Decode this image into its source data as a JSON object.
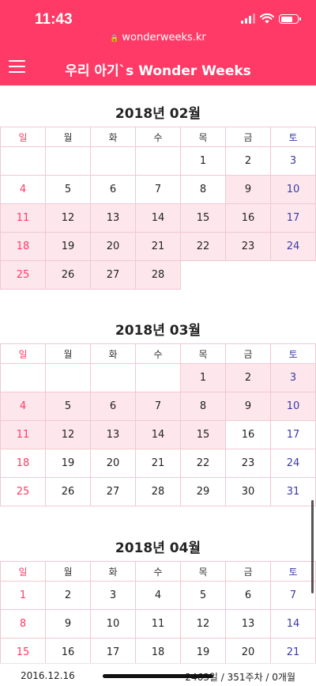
{
  "status_bar": {
    "time": "11:43"
  },
  "browser": {
    "url": "wonderweeks.kr"
  },
  "app": {
    "title": "우리 아기`s Wonder Weeks"
  },
  "weekday_labels": [
    "일",
    "월",
    "화",
    "수",
    "목",
    "금",
    "토"
  ],
  "months": [
    {
      "title": "2018년 02월",
      "weeks": [
        [
          "",
          "",
          "",
          "",
          "1",
          "2",
          "3"
        ],
        [
          "4",
          "5",
          "6",
          "7",
          "8",
          "9",
          "10"
        ],
        [
          "11",
          "12",
          "13",
          "14",
          "15",
          "16",
          "17"
        ],
        [
          "18",
          "19",
          "20",
          "21",
          "22",
          "23",
          "24"
        ],
        [
          "25",
          "26",
          "27",
          "28",
          "",
          "",
          ""
        ]
      ],
      "highlighted": [
        "9",
        "10",
        "11",
        "12",
        "13",
        "14",
        "15",
        "16",
        "17",
        "18",
        "19",
        "20",
        "21",
        "22",
        "23",
        "24",
        "25",
        "26",
        "27",
        "28"
      ]
    },
    {
      "title": "2018년 03월",
      "weeks": [
        [
          "",
          "",
          "",
          "",
          "1",
          "2",
          "3"
        ],
        [
          "4",
          "5",
          "6",
          "7",
          "8",
          "9",
          "10"
        ],
        [
          "11",
          "12",
          "13",
          "14",
          "15",
          "16",
          "17"
        ],
        [
          "18",
          "19",
          "20",
          "21",
          "22",
          "23",
          "24"
        ],
        [
          "25",
          "26",
          "27",
          "28",
          "29",
          "30",
          "31"
        ]
      ],
      "highlighted": [
        "1",
        "2",
        "3",
        "4",
        "5",
        "6",
        "7",
        "8",
        "9",
        "10",
        "11",
        "12",
        "13",
        "14",
        "15"
      ]
    },
    {
      "title": "2018년 04월",
      "weeks": [
        [
          "1",
          "2",
          "3",
          "4",
          "5",
          "6",
          "7"
        ],
        [
          "8",
          "9",
          "10",
          "11",
          "12",
          "13",
          "14"
        ],
        [
          "15",
          "16",
          "17",
          "18",
          "19",
          "20",
          "21"
        ]
      ],
      "highlighted": []
    }
  ],
  "footer": {
    "birth_date": "2016.12.16",
    "age_summary": "2463일 / 351주차 / 0개월"
  },
  "colors": {
    "accent": "#ff3a66",
    "sunday": "#ff3a66",
    "saturday": "#3a3aa8",
    "highlight": "#fde7ec"
  }
}
